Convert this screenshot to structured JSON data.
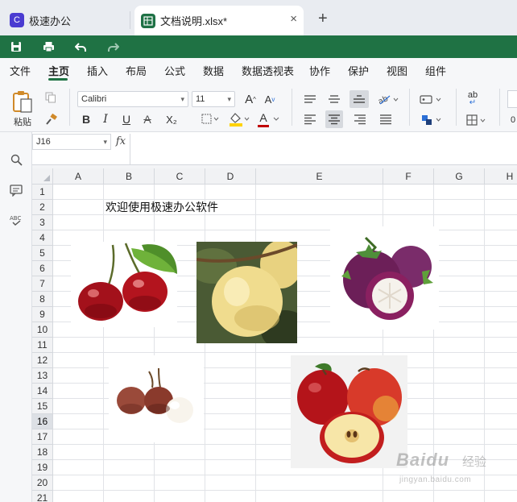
{
  "tabs": {
    "app": {
      "label": "极速办公",
      "icon": "app-logo-icon"
    },
    "document": {
      "label": "文档说明.xlsx*",
      "icon": "spreadsheet-icon",
      "close": "×"
    },
    "add": "+"
  },
  "quick_access": [
    "save-icon",
    "print-icon",
    "undo-icon",
    "redo-icon"
  ],
  "menu": {
    "items": [
      "文件",
      "主页",
      "插入",
      "布局",
      "公式",
      "数据",
      "数据透视表",
      "协作",
      "保护",
      "视图",
      "组件"
    ],
    "active": "主页"
  },
  "ribbon": {
    "paste_label": "粘贴",
    "font_name": "Calibri",
    "font_size": "11",
    "bold": "B",
    "italic": "I",
    "underline": "U",
    "strike": "A",
    "subscript": "X₂",
    "increase_font": "A",
    "decrease_font": "A",
    "font_color": "A",
    "spellcheck": "ab",
    "partial_label": "0"
  },
  "formula_bar": {
    "cell_ref": "J16",
    "fx": "fx",
    "value": ""
  },
  "grid": {
    "columns": [
      "A",
      "B",
      "C",
      "D",
      "E",
      "F",
      "G",
      "H"
    ],
    "rows": [
      "1",
      "2",
      "3",
      "4",
      "5",
      "6",
      "7",
      "8",
      "9",
      "10",
      "11",
      "12",
      "13",
      "14",
      "15",
      "16",
      "17",
      "18",
      "19",
      "20",
      "21"
    ],
    "active_row": "16",
    "cell_B2": "欢迎使用极速办公软件"
  },
  "images": [
    {
      "name": "cherries-image",
      "subject": "cherries"
    },
    {
      "name": "yellow-pear-image",
      "subject": "yellow pear on tree"
    },
    {
      "name": "mangosteen-image",
      "subject": "mangosteen"
    },
    {
      "name": "lychee-image",
      "subject": "lychee"
    },
    {
      "name": "apples-image",
      "subject": "red apples"
    }
  ],
  "watermark": {
    "brand": "Baidu",
    "word": "经验",
    "url": "jingyan.baidu.com"
  },
  "colors": {
    "accent_green": "#1f7244",
    "app_purple": "#4a3bd1",
    "font_color_red": "#c00000",
    "fill_yellow": "#ffd200"
  }
}
